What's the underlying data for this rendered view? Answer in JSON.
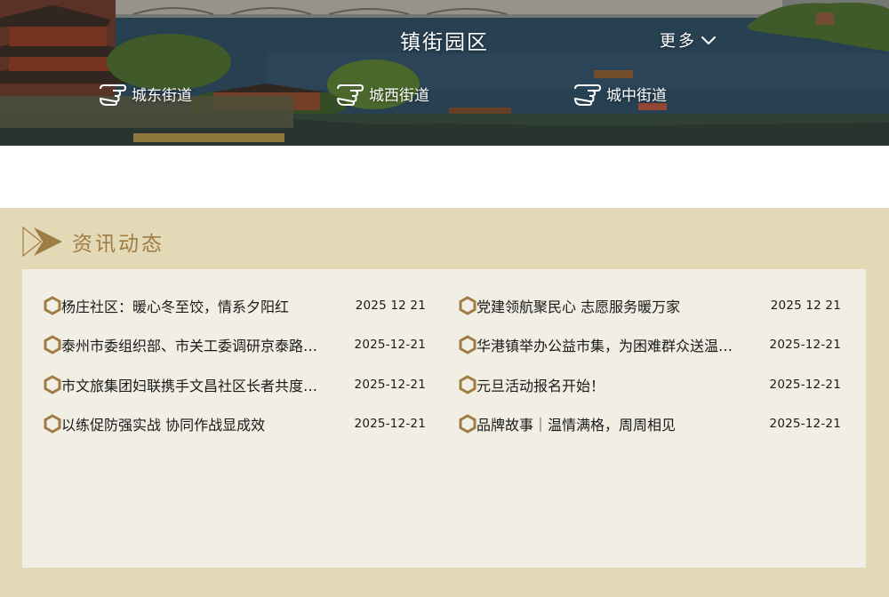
{
  "banner": {
    "title": "镇街园区",
    "more_label": "更多",
    "streets": [
      {
        "label": "城东街道"
      },
      {
        "label": "城西街道"
      },
      {
        "label": "城中街道"
      }
    ]
  },
  "news": {
    "section_title": "资讯动态",
    "left_items": [
      {
        "title": "杨庄社区：暖心冬至饺，情系夕阳红",
        "date": "2025 12 21"
      },
      {
        "title": "泰州市委组织部、市关工委调研京泰路街道“五老”参与...",
        "date": "2025-12-21"
      },
      {
        "title": "市文旅集团妇联携手文昌社区长者共度冬至...",
        "date": "2025-12-21"
      },
      {
        "title": "以练促防强实战 协同作战显成效",
        "date": "2025-12-21"
      }
    ],
    "right_items": [
      {
        "title": "党建领航聚民心 志愿服务暖万家",
        "date": "2025 12 21"
      },
      {
        "title": "华港镇举办公益市集，为困难群众送温暖...",
        "date": "2025-12-21"
      },
      {
        "title": "元旦活动报名开始！",
        "date": "2025-12-21"
      },
      {
        "title": "品牌故事｜温情满格，周周相见",
        "date": "2025-12-21"
      }
    ]
  },
  "colors": {
    "section_bg": "#e3d9b7",
    "panel_bg": "#f1eee4",
    "accent": "#a07c45"
  },
  "icons": {
    "more": "chevron-down-icon",
    "street": "pointing-hand-icon",
    "section": "double-arrow-icon",
    "bullet": "hexagon-bullet-icon"
  }
}
